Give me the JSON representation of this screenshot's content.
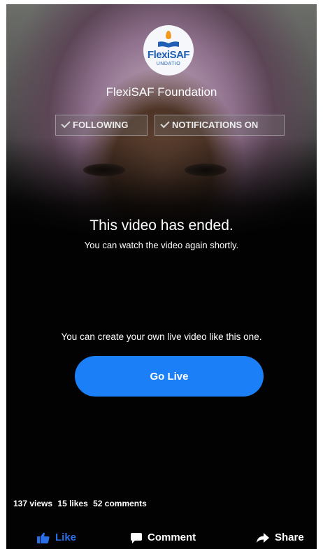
{
  "page": {
    "logo": {
      "brand": "FlexiSAF",
      "sub": "UNDATIO"
    },
    "name": "FlexiSAF Foundation",
    "following_label": "FOLLOWING",
    "notifications_label": "NOTIFICATIONS ON"
  },
  "video": {
    "ended_title": "This video has ended.",
    "ended_subtitle": "You can watch the video again shortly.",
    "create_prompt": "You can create your own live video like this one.",
    "go_live_label": "Go Live"
  },
  "stats": {
    "views": "137 views",
    "likes": "15 likes",
    "comments": "52 comments"
  },
  "actions": {
    "like": "Like",
    "comment": "Comment",
    "share": "Share"
  },
  "colors": {
    "accent": "#1b80f8",
    "like_active": "#2a6fe8"
  },
  "icons": {
    "like": "thumbs-up-icon",
    "comment": "speech-bubble-icon",
    "share": "share-arrow-icon",
    "following": "check-icon",
    "notifications": "check-icon"
  }
}
